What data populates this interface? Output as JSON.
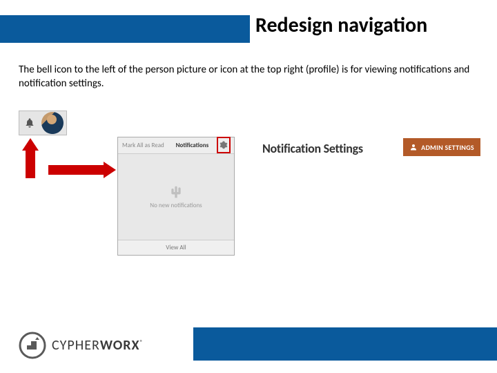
{
  "header": {
    "title": "Redesign navigation"
  },
  "body": {
    "text": "The bell icon to the left of the person picture or icon at the top right (profile) is for viewing notifications and notification settings."
  },
  "panel": {
    "tab_unread": "Mark All as Read",
    "tab_notifications": "Notifications",
    "empty_text": "No new notifications",
    "footer": "View All"
  },
  "labels": {
    "notification_settings": "Notification Settings",
    "admin_settings": "ADMIN SETTINGS"
  },
  "logo": {
    "part1": "CYPHER",
    "part2": "WORX"
  }
}
